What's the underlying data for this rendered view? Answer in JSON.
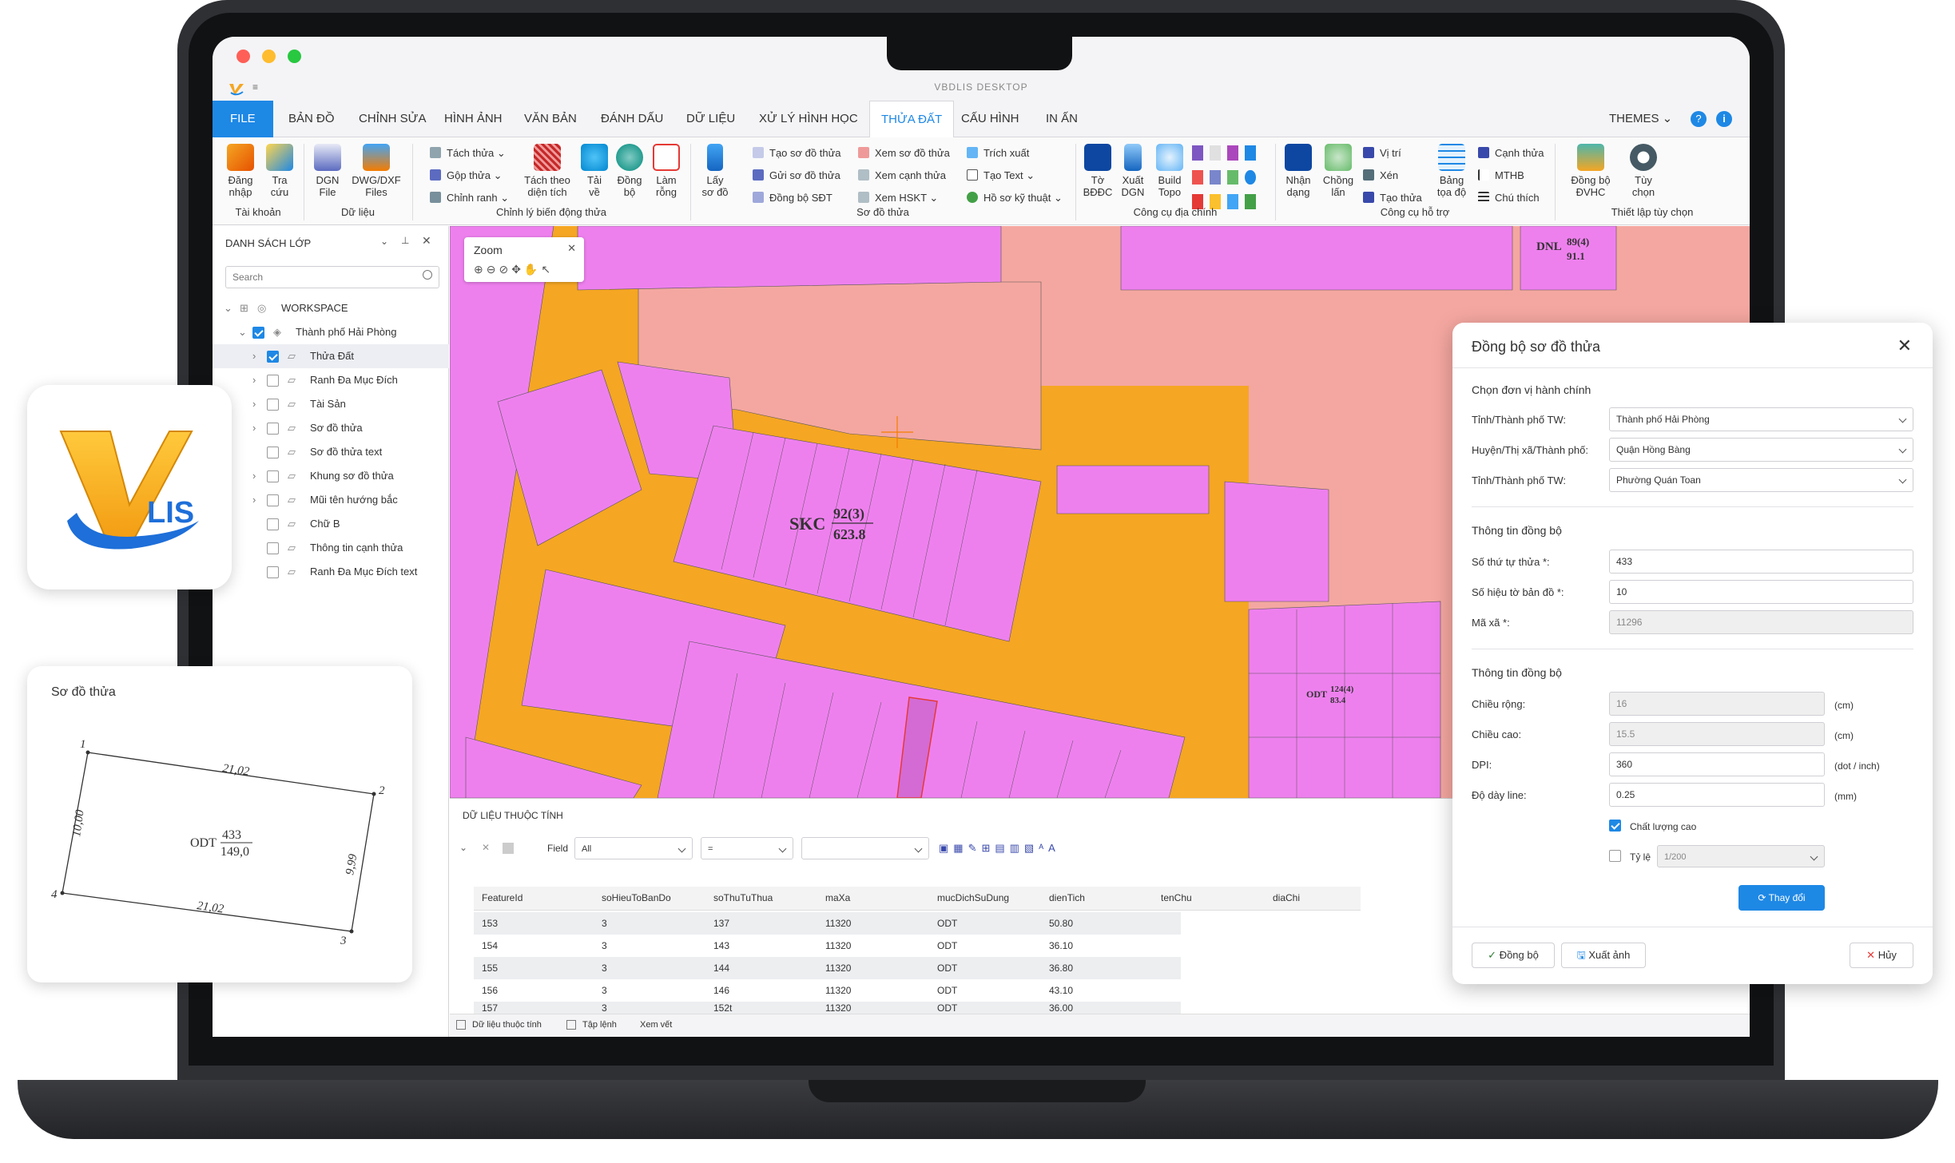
{
  "window": {
    "title": "VBDLIS DESKTOP"
  },
  "menu": [
    "FILE",
    "BẢN ĐỒ",
    "CHỈNH SỬA",
    "HÌNH ẢNH",
    "VĂN BẢN",
    "ĐÁNH DẤU",
    "DỮ LIỆU",
    "XỬ LÝ HÌNH HỌC",
    "THỬA ĐẤT",
    "CẤU HÌNH",
    "IN ẤN"
  ],
  "menu_active": "THỬA ĐẤT",
  "themes_label": "THEMES",
  "ribbon": {
    "groups": [
      "Tài khoản",
      "Dữ liệu",
      "Chỉnh lý biến động thửa",
      "Sơ đồ thửa",
      "Công cụ địa chính",
      "Công cụ hỗ trợ",
      "Thiết lập tùy chọn"
    ],
    "big": {
      "dang_nhap": [
        "Đăng",
        "nhập"
      ],
      "tra_cuu": [
        "Tra",
        "cứu"
      ],
      "dgn_file": [
        "DGN",
        "File"
      ],
      "dwg_files": [
        "DWG/DXF",
        "Files"
      ],
      "tach_theo": [
        "Tách theo",
        "diện tích"
      ],
      "tai_ve": [
        "Tải",
        "về"
      ],
      "dong_bo": [
        "Đồng",
        "bộ"
      ],
      "lam_rong": [
        "Làm",
        "rỗng"
      ],
      "lay_so_do": [
        "Lấy",
        "sơ đồ"
      ],
      "to_bddc": [
        "Tờ",
        "BĐĐC"
      ],
      "xuat_dgn": [
        "Xuất",
        "DGN"
      ],
      "build_topo": [
        "Build",
        "Topo"
      ],
      "nhan_dang": [
        "Nhận",
        "dạng"
      ],
      "chong_lan": [
        "Chồng",
        "lấn"
      ],
      "bang_toa_do": [
        "Bảng",
        "tọa độ"
      ],
      "dong_bo_dvhc": [
        "Đồng bộ",
        "ĐVHC"
      ],
      "tuy_chon": [
        "Tùy",
        "chọn"
      ]
    },
    "small": {
      "tach_thua": "Tách thửa",
      "gop_thua": "Gộp thửa",
      "chinh_ranh": "Chỉnh ranh",
      "tao_sd": "Tạo sơ đồ thửa",
      "gui_sd": "Gửi sơ đồ thửa",
      "dong_bo_sdt": "Đồng bộ SĐT",
      "xem_sd": "Xem sơ đồ thửa",
      "xem_canh": "Xem cạnh thửa",
      "xem_hskt": "Xem HSKT",
      "trich_xuat": "Trích xuất",
      "tao_text": "Tạo Text",
      "ho_so_ky_thuat": "Hồ sơ kỹ thuật",
      "vi_tri": "Vị trí",
      "xen": "Xén",
      "tao_thua": "Tạo thửa",
      "canh_thua": "Cạnh thửa",
      "mthb": "MTHB",
      "chu_thich": "Chú thích"
    }
  },
  "layers": {
    "title": "DANH SÁCH LỚP",
    "search_placeholder": "Search",
    "items": [
      {
        "label": "WORKSPACE"
      },
      {
        "label": "Thành phố Hải Phòng"
      },
      {
        "label": "Thửa Đất"
      },
      {
        "label": "Ranh Đa Mục Đích"
      },
      {
        "label": "Tài Sản"
      },
      {
        "label": "Sơ đồ thửa"
      },
      {
        "label": "Sơ đồ thửa text"
      },
      {
        "label": "Khung sơ đồ thửa"
      },
      {
        "label": "Mũi tên hướng bắc"
      },
      {
        "label": "Chữ B"
      },
      {
        "label": "Thông tin cạnh thửa"
      },
      {
        "label": "Ranh Đa Mục Đích text"
      }
    ]
  },
  "map": {
    "zoom_title": "Zoom",
    "skc_code": "SKC",
    "skc_num": "92(3)",
    "skc_area": "623.8",
    "dnl_code": "DNL",
    "dnl_num": "89(4)",
    "dnl_area": "91.1",
    "odt_code": "ODT",
    "odt_num": "124(4)",
    "odt_area": "83.4"
  },
  "attributes": {
    "title": "DỮ LIỆU THUỘC TÍNH",
    "field_label": "Field",
    "field_value": "All",
    "operator": "=",
    "columns": [
      "FeatureId",
      "soHieuToBanDo",
      "soThuTuThua",
      "maXa",
      "mucDichSuDung",
      "dienTich",
      "tenChu",
      "diaChi"
    ],
    "rows": [
      [
        "153",
        "3",
        "137",
        "11320",
        "ODT",
        "50.80"
      ],
      [
        "154",
        "3",
        "143",
        "11320",
        "ODT",
        "36.10"
      ],
      [
        "155",
        "3",
        "144",
        "11320",
        "ODT",
        "36.80"
      ],
      [
        "156",
        "3",
        "146",
        "11320",
        "ODT",
        "43.10"
      ],
      [
        "157",
        "3",
        "152t",
        "11320",
        "ODT",
        "36.00"
      ]
    ],
    "status_tabs": [
      "Dữ liệu thuộc tính",
      "Tập lệnh",
      "Xem vết"
    ]
  },
  "logo": {
    "text": "LIS"
  },
  "parcel_card": {
    "title": "Sơ đồ thửa",
    "points": [
      "1",
      "2",
      "3",
      "4"
    ],
    "edges": [
      "21,02",
      "9,99",
      "21,02",
      "10,00"
    ],
    "code": "ODT",
    "num": "433",
    "area": "149,0"
  },
  "dialog": {
    "title": "Đồng bộ sơ đồ thửa",
    "section1": "Chọn đơn vị hành chính",
    "province_label": "Tỉnh/Thành phố TW:",
    "province_value": "Thành phố Hải Phòng",
    "district_label": "Huyện/Thị xã/Thành phố:",
    "district_value": "Quận Hồng Bàng",
    "ward_label": "Tỉnh/Thành phố TW:",
    "ward_value": "Phường Quán Toan",
    "section2": "Thông tin đồng bộ",
    "parcel_no_label": "Số thứ tự thửa *:",
    "parcel_no_value": "433",
    "map_sheet_label": "Số hiệu tờ bản đồ *:",
    "map_sheet_value": "10",
    "commune_label": "Mã xã *:",
    "commune_value": "11296",
    "section3": "Thông tin đồng bộ",
    "width_label": "Chiều rộng:",
    "width_value": "16",
    "width_unit": "(cm)",
    "height_label": "Chiều cao:",
    "height_value": "15.5",
    "height_unit": "(cm)",
    "dpi_label": "DPI:",
    "dpi_value": "360",
    "dpi_unit": "(dot / inch)",
    "line_label": "Độ dày line:",
    "line_value": "0.25",
    "line_unit": "(mm)",
    "quality_label": "Chất lượng cao",
    "scale_label": "Tỷ lệ",
    "scale_value": "1/200",
    "change_button": "Thay đổi",
    "sync_button": "Đồng bộ",
    "export_button": "Xuất ảnh",
    "cancel_button": "Hủy"
  },
  "colors": {
    "accent": "#1e88e5",
    "parcel": "#ee80ee",
    "road": "#f5a623",
    "skc": "#f4a7a0",
    "laptop": "#2f3034"
  }
}
